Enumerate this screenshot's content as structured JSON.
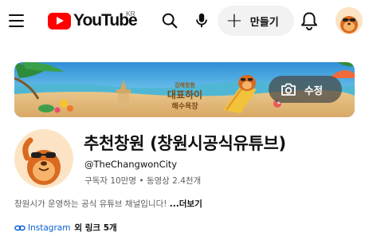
{
  "header": {
    "logo_text": "YouTube",
    "region": "KR",
    "create_label": "만들기"
  },
  "banner": {
    "edit_label": "수정",
    "sand_text_line1": "김해창원",
    "sand_text_line2": "대표하이",
    "sand_text_line3": "해수욕장"
  },
  "channel": {
    "title": "추천창원 (창원시공식유튜브)",
    "handle": "@TheChangwonCity",
    "stats": "구독자 10만명 • 동영상 2.4천개",
    "description": "창원시가 운영하는 공식 유튜브 채널입니다! ",
    "more_label": "...더보기",
    "link_label": "Instagram",
    "other_links": "외 링크 5개"
  },
  "colors": {
    "brand_red": "#ff0000",
    "link_blue": "#065fd4",
    "text_secondary": "#606060"
  }
}
